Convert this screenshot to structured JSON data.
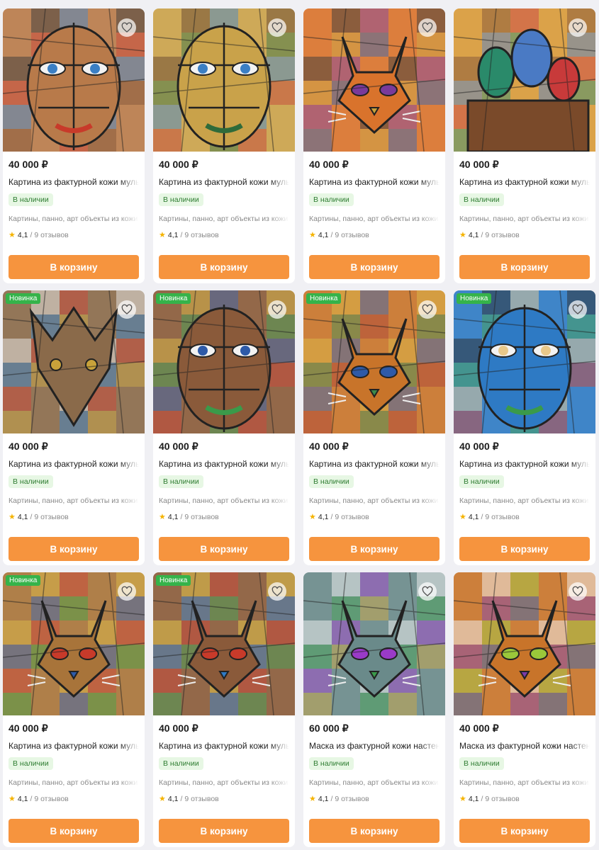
{
  "products": [
    {
      "price": "40 000 ₽",
      "title": "Картина из фактурной кожи мультиколор",
      "stock": "В наличии",
      "category": "Картины, панно, арт объекты из кожи",
      "rating": "4,1",
      "reviews": "/ 9 отзывов",
      "badge": "",
      "cart": "В корзину",
      "art": "face-man",
      "palette": [
        "#b87a4a",
        "#7a4a2a",
        "#3b7fc4",
        "#c83a2a",
        "#2b2b2b"
      ]
    },
    {
      "price": "40 000 ₽",
      "title": "Картина из фактурной кожи мультиколор",
      "stock": "В наличии",
      "category": "Картины, панно, арт объекты из кожи",
      "rating": "4,1",
      "reviews": "/ 9 отзывов",
      "badge": "",
      "cart": "В корзину",
      "art": "face-woman",
      "palette": [
        "#c9a24a",
        "#c0392b",
        "#3b7fc4",
        "#2f6b3a",
        "#5a3a22"
      ]
    },
    {
      "price": "40 000 ₽",
      "title": "Картина из фактурной кожи мультиколор",
      "stock": "В наличии",
      "category": "Картины, панно, арт объекты из кожи",
      "rating": "4,1",
      "reviews": "/ 9 отзывов",
      "badge": "",
      "cart": "В корзину",
      "art": "cat-face",
      "palette": [
        "#d9732c",
        "#2e5aa8",
        "#7a3a9a",
        "#c8a23a",
        "#2b2b2b"
      ]
    },
    {
      "price": "40 000 ₽",
      "title": "Картина из фактурной кожи мультиколор",
      "stock": "В наличии",
      "category": "Картины, панно, арт объекты из кожи",
      "rating": "4,1",
      "reviews": "/ 9 отзывов",
      "badge": "",
      "cart": "В корзину",
      "art": "domes",
      "palette": [
        "#d89a3a",
        "#2a8a6a",
        "#c83a3a",
        "#4a7ac4",
        "#7a4a2a"
      ]
    },
    {
      "price": "40 000 ₽",
      "title": "Картина из фактурной кожи мультиколор",
      "stock": "В наличии",
      "category": "Картины, панно, арт объекты из кожи",
      "rating": "4,1",
      "reviews": "/ 9 отзывов",
      "badge": "Новинка",
      "cart": "В корзину",
      "art": "dragon",
      "palette": [
        "#8a6a4a",
        "#c8a23a",
        "#c83a2a",
        "#2e7ac4",
        "#e8e8e8"
      ]
    },
    {
      "price": "40 000 ₽",
      "title": "Картина из фактурной кожи мультиколор",
      "stock": "В наличии",
      "category": "Картины, панно, арт объекты из кожи",
      "rating": "4,1",
      "reviews": "/ 9 отзывов",
      "badge": "Новинка",
      "cart": "В корзину",
      "art": "warrior",
      "palette": [
        "#8a5a3a",
        "#c83a2a",
        "#2e5aa8",
        "#3a9a4a",
        "#d8b43a"
      ]
    },
    {
      "price": "40 000 ₽",
      "title": "Картина из фактурной кожи мультиколор",
      "stock": "В наличии",
      "category": "Картины, панно, арт объекты из кожи",
      "rating": "4,1",
      "reviews": "/ 9 отзывов",
      "badge": "Новинка",
      "cart": "В корзину",
      "art": "cat-sit",
      "palette": [
        "#c8742a",
        "#a83a2a",
        "#2e5aa8",
        "#3a8a4a",
        "#d8b43a"
      ]
    },
    {
      "price": "40 000 ₽",
      "title": "Картина из фактурной кожи мультиколор",
      "stock": "В наличии",
      "category": "Картины, панно, арт объекты из кожи",
      "rating": "4,1",
      "reviews": "/ 9 отзывов",
      "badge": "Новинка",
      "cart": "В корзину",
      "art": "face-cubist",
      "palette": [
        "#2e7ac4",
        "#c83a2a",
        "#e8c88a",
        "#3a9a4a",
        "#1a1a1a"
      ]
    },
    {
      "price": "40 000 ₽",
      "title": "Картина из фактурной кожи мультиколор",
      "stock": "В наличии",
      "category": "Картины, панно, арт объекты из кожи",
      "rating": "4,1",
      "reviews": "/ 9 отзывов",
      "badge": "Новинка",
      "cart": "В корзину",
      "art": "cat-green",
      "palette": [
        "#a8743a",
        "#3a9a3a",
        "#c83a2a",
        "#2e5aa8",
        "#d8b43a"
      ]
    },
    {
      "price": "40 000 ₽",
      "title": "Картина из фактурной кожи мультиколор",
      "stock": "В наличии",
      "category": "Картины, панно, арт объекты из кожи",
      "rating": "4,1",
      "reviews": "/ 9 отзывов",
      "badge": "Новинка",
      "cart": "В корзину",
      "art": "cat-walk",
      "palette": [
        "#8a5a3a",
        "#3a9a4a",
        "#c83a2a",
        "#2e7ac4",
        "#e8c83a"
      ]
    },
    {
      "price": "60 000 ₽",
      "title": "Маска из фактурной кожи настенная",
      "stock": "В наличии",
      "category": "Картины, панно, арт объекты из кожи",
      "rating": "4,1",
      "reviews": "/ 9 отзывов",
      "badge": "",
      "cart": "В корзину",
      "art": "mask",
      "palette": [
        "#6a8a8a",
        "#c8a23a",
        "#9a3ac8",
        "#3a9a4a",
        "#f2f2f2"
      ]
    },
    {
      "price": "40 000 ₽",
      "title": "Маска из фактурной кожи настенная",
      "stock": "В наличии",
      "category": "Картины, панно, арт объекты из кожи",
      "rating": "4,1",
      "reviews": "/ 9 отзывов",
      "badge": "",
      "cart": "В корзину",
      "art": "cat-blue",
      "palette": [
        "#c8742a",
        "#2e5aa8",
        "#9ac83a",
        "#7a3aa8",
        "#f2f2f2"
      ]
    }
  ]
}
